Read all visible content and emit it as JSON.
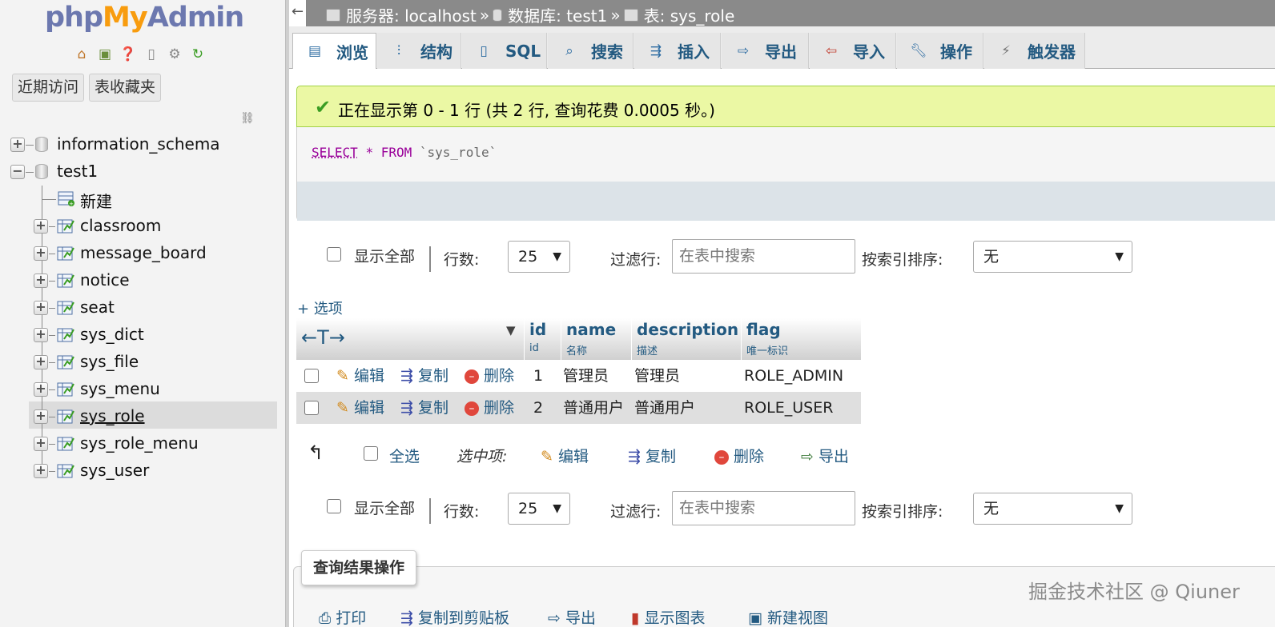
{
  "app": {
    "logo": {
      "php": "php",
      "my": "My",
      "admin": "Admin"
    },
    "nav_buttons": {
      "recent": "近期访问",
      "favorites": "表收藏夹"
    }
  },
  "nav_tree": {
    "databases": [
      {
        "name": "information_schema"
      },
      {
        "name": "test1"
      }
    ],
    "new_label": "新建",
    "tables": [
      "classroom",
      "message_board",
      "notice",
      "seat",
      "sys_dict",
      "sys_file",
      "sys_menu",
      "sys_role",
      "sys_role_menu",
      "sys_user"
    ],
    "selected_table": "sys_role"
  },
  "breadcrumb": {
    "back": "←",
    "server": "服务器: localhost",
    "database": "数据库: test1",
    "table": "表: sys_role",
    "separator": "»"
  },
  "tabs": [
    "浏览",
    "结构",
    "SQL",
    "搜索",
    "插入",
    "导出",
    "导入",
    "操作",
    "触发器"
  ],
  "success_message": "正在显示第 0 - 1 行 (共 2 行, 查询花费 0.0005 秒。)",
  "sql": {
    "select": "SELECT",
    "star": "*",
    "from": "FROM",
    "table": "`sys_role`"
  },
  "controls": {
    "show_all": "显示全部",
    "rows_label": "行数:",
    "rows_value": "25",
    "filter_label": "过滤行:",
    "filter_placeholder": "在表中搜索",
    "sort_label": "按索引排序:",
    "sort_value": "无"
  },
  "options_link": "+ 选项",
  "table": {
    "arrows": "←T→",
    "columns": [
      {
        "name": "id",
        "comment": "id"
      },
      {
        "name": "name",
        "comment": "名称"
      },
      {
        "name": "description",
        "comment": "描述"
      },
      {
        "name": "flag",
        "comment": "唯一标识"
      }
    ],
    "row_actions": {
      "edit": "编辑",
      "copy": "复制",
      "delete": "删除"
    },
    "rows": [
      {
        "id": "1",
        "name": "管理员",
        "description": "管理员",
        "flag": "ROLE_ADMIN"
      },
      {
        "id": "2",
        "name": "普通用户",
        "description": "普通用户",
        "flag": "ROLE_USER"
      }
    ]
  },
  "bulk": {
    "select_all": "全选",
    "with_selected": "选中项:",
    "edit": "编辑",
    "copy": "复制",
    "delete": "删除",
    "export": "导出"
  },
  "query_ops": {
    "legend": "查询结果操作",
    "links": [
      "打印",
      "复制到剪贴板",
      "导出",
      "显示图表",
      "新建视图"
    ]
  },
  "watermark": "掘金技术社区 @ Qiuner"
}
